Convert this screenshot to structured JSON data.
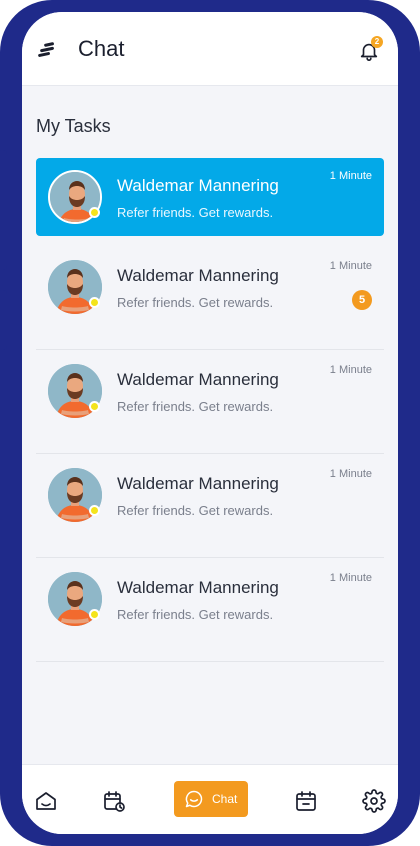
{
  "header": {
    "title": "Chat",
    "notification_count": "2"
  },
  "section": {
    "title": "My Tasks"
  },
  "tasks": [
    {
      "name": "Waldemar Mannering",
      "message": "Refer friends. Get rewards.",
      "time": "1 Minute",
      "unread": "",
      "active": true
    },
    {
      "name": "Waldemar Mannering",
      "message": "Refer friends. Get rewards.",
      "time": "1 Minute",
      "unread": "5",
      "active": false
    },
    {
      "name": "Waldemar Mannering",
      "message": "Refer friends. Get rewards.",
      "time": "1 Minute",
      "unread": "",
      "active": false
    },
    {
      "name": "Waldemar Mannering",
      "message": "Refer friends. Get rewards.",
      "time": "1 Minute",
      "unread": "",
      "active": false
    },
    {
      "name": "Waldemar Mannering",
      "message": "Refer friends. Get rewards.",
      "time": "1 Minute",
      "unread": "",
      "active": false
    }
  ],
  "bottom_nav": {
    "items": [
      {
        "icon": "home-icon"
      },
      {
        "icon": "calendar-clock-icon"
      },
      {
        "icon": "chat-bubble-icon",
        "label": "Chat"
      },
      {
        "icon": "calendar-icon"
      },
      {
        "icon": "gear-icon"
      }
    ]
  },
  "colors": {
    "frame": "#1f2a8a",
    "active_row": "#03a9e8",
    "accent": "#f39a1f",
    "status_dot": "#f4e41c"
  }
}
